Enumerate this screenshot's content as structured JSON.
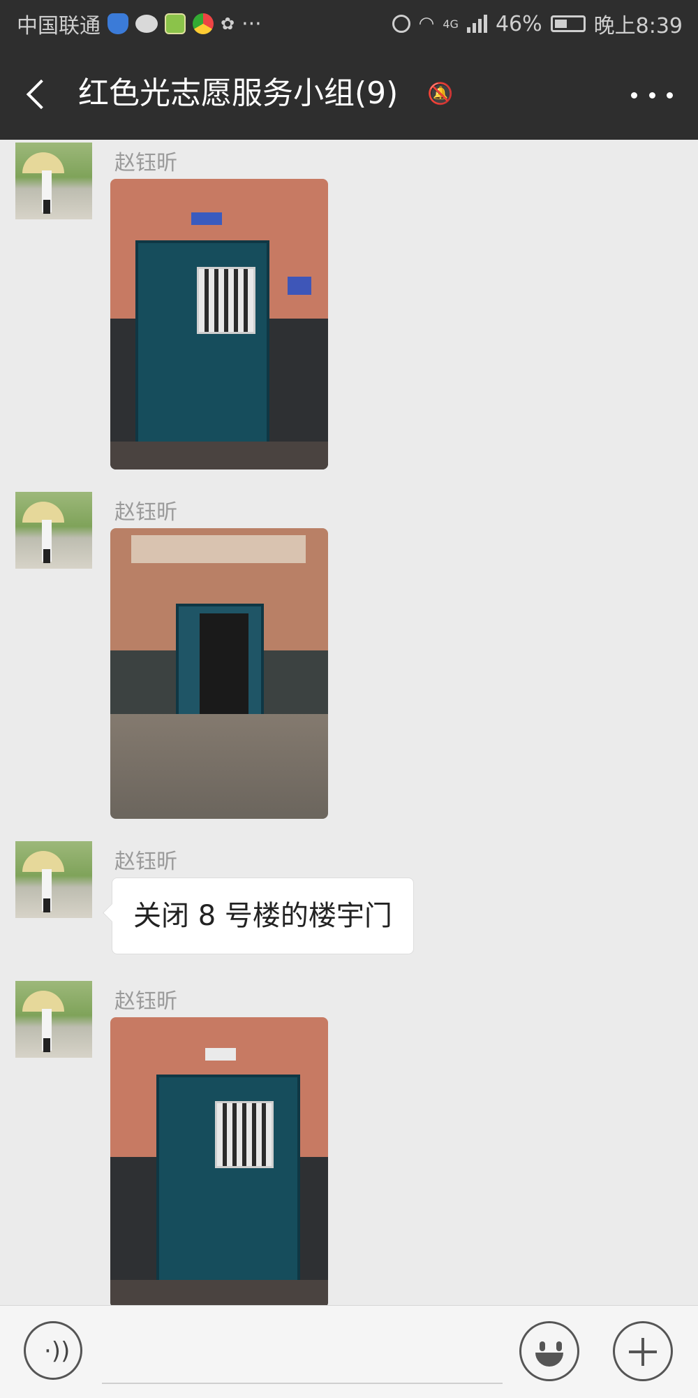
{
  "status_bar": {
    "carrier": "中国联通",
    "extra_indicator": "···",
    "network": "4G",
    "battery": "46%",
    "time": "晚上8:39"
  },
  "header": {
    "title": "红色光志愿服务小组(9)"
  },
  "messages": [
    {
      "sender": "赵钰昕",
      "type": "image"
    },
    {
      "sender": "赵钰昕",
      "type": "image"
    },
    {
      "sender": "赵钰昕",
      "type": "text",
      "text": "关闭 8 号楼的楼宇门"
    },
    {
      "sender": "赵钰昕",
      "type": "image"
    }
  ],
  "input_bar": {
    "voice_icon": "voice-icon",
    "emoji_icon": "emoji-icon",
    "plus_icon": "plus-icon"
  }
}
